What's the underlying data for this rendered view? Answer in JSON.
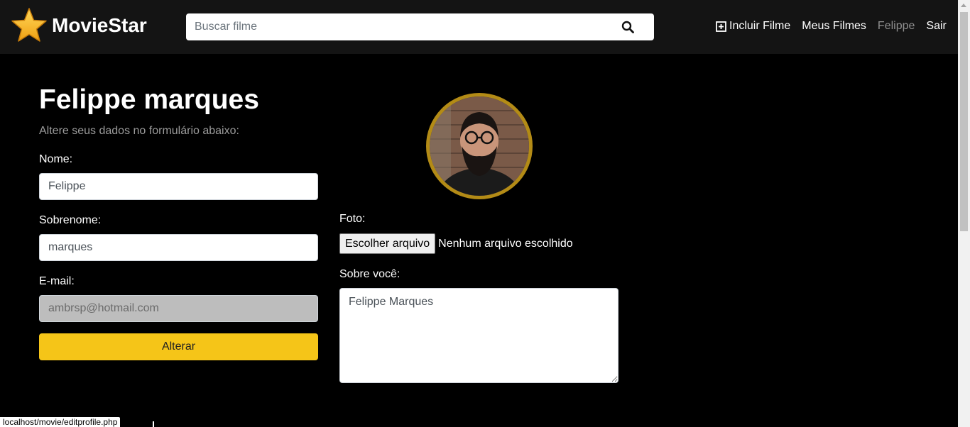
{
  "header": {
    "brand": "MovieStar",
    "search_placeholder": "Buscar filme",
    "nav": {
      "add_movie": "Incluir Filme",
      "my_movies": "Meus Filmes",
      "user": "Felippe",
      "logout": "Sair"
    }
  },
  "profile": {
    "title": "Felippe marques",
    "subtitle": "Altere seus dados no formulário abaixo:",
    "name_label": "Nome:",
    "name_value": "Felippe",
    "lastname_label": "Sobrenome:",
    "lastname_value": "marques",
    "email_label": "E-mail:",
    "email_value": "ambrsp@hotmail.com",
    "submit_label": "Alterar",
    "photo_label": "Foto:",
    "file_button": "Escolher arquivo",
    "file_status": "Nenhum arquivo escolhido",
    "bio_label": "Sobre você:",
    "bio_value": "Felippe Marques"
  },
  "status_bar": {
    "url": "localhost/movie/editprofile.php"
  },
  "colors": {
    "accent": "#f5c518",
    "header_bg": "#141414",
    "avatar_ring": "#b38b16"
  },
  "icons": [
    "star-logo-icon",
    "search-icon",
    "plus-square-icon"
  ]
}
